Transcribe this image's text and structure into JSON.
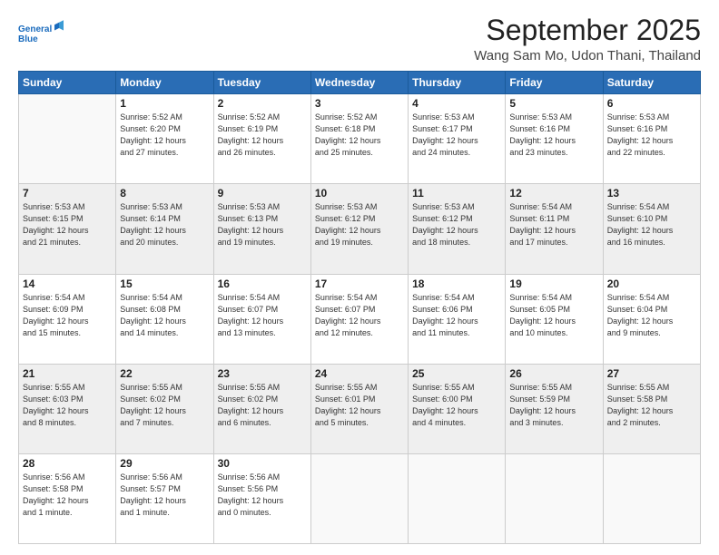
{
  "header": {
    "logo_line1": "General",
    "logo_line2": "Blue",
    "title": "September 2025",
    "subtitle": "Wang Sam Mo, Udon Thani, Thailand"
  },
  "days_of_week": [
    "Sunday",
    "Monday",
    "Tuesday",
    "Wednesday",
    "Thursday",
    "Friday",
    "Saturday"
  ],
  "weeks": [
    [
      {
        "num": "",
        "info": ""
      },
      {
        "num": "1",
        "info": "Sunrise: 5:52 AM\nSunset: 6:20 PM\nDaylight: 12 hours\nand 27 minutes."
      },
      {
        "num": "2",
        "info": "Sunrise: 5:52 AM\nSunset: 6:19 PM\nDaylight: 12 hours\nand 26 minutes."
      },
      {
        "num": "3",
        "info": "Sunrise: 5:52 AM\nSunset: 6:18 PM\nDaylight: 12 hours\nand 25 minutes."
      },
      {
        "num": "4",
        "info": "Sunrise: 5:53 AM\nSunset: 6:17 PM\nDaylight: 12 hours\nand 24 minutes."
      },
      {
        "num": "5",
        "info": "Sunrise: 5:53 AM\nSunset: 6:16 PM\nDaylight: 12 hours\nand 23 minutes."
      },
      {
        "num": "6",
        "info": "Sunrise: 5:53 AM\nSunset: 6:16 PM\nDaylight: 12 hours\nand 22 minutes."
      }
    ],
    [
      {
        "num": "7",
        "info": "Sunrise: 5:53 AM\nSunset: 6:15 PM\nDaylight: 12 hours\nand 21 minutes."
      },
      {
        "num": "8",
        "info": "Sunrise: 5:53 AM\nSunset: 6:14 PM\nDaylight: 12 hours\nand 20 minutes."
      },
      {
        "num": "9",
        "info": "Sunrise: 5:53 AM\nSunset: 6:13 PM\nDaylight: 12 hours\nand 19 minutes."
      },
      {
        "num": "10",
        "info": "Sunrise: 5:53 AM\nSunset: 6:12 PM\nDaylight: 12 hours\nand 19 minutes."
      },
      {
        "num": "11",
        "info": "Sunrise: 5:53 AM\nSunset: 6:12 PM\nDaylight: 12 hours\nand 18 minutes."
      },
      {
        "num": "12",
        "info": "Sunrise: 5:54 AM\nSunset: 6:11 PM\nDaylight: 12 hours\nand 17 minutes."
      },
      {
        "num": "13",
        "info": "Sunrise: 5:54 AM\nSunset: 6:10 PM\nDaylight: 12 hours\nand 16 minutes."
      }
    ],
    [
      {
        "num": "14",
        "info": "Sunrise: 5:54 AM\nSunset: 6:09 PM\nDaylight: 12 hours\nand 15 minutes."
      },
      {
        "num": "15",
        "info": "Sunrise: 5:54 AM\nSunset: 6:08 PM\nDaylight: 12 hours\nand 14 minutes."
      },
      {
        "num": "16",
        "info": "Sunrise: 5:54 AM\nSunset: 6:07 PM\nDaylight: 12 hours\nand 13 minutes."
      },
      {
        "num": "17",
        "info": "Sunrise: 5:54 AM\nSunset: 6:07 PM\nDaylight: 12 hours\nand 12 minutes."
      },
      {
        "num": "18",
        "info": "Sunrise: 5:54 AM\nSunset: 6:06 PM\nDaylight: 12 hours\nand 11 minutes."
      },
      {
        "num": "19",
        "info": "Sunrise: 5:54 AM\nSunset: 6:05 PM\nDaylight: 12 hours\nand 10 minutes."
      },
      {
        "num": "20",
        "info": "Sunrise: 5:54 AM\nSunset: 6:04 PM\nDaylight: 12 hours\nand 9 minutes."
      }
    ],
    [
      {
        "num": "21",
        "info": "Sunrise: 5:55 AM\nSunset: 6:03 PM\nDaylight: 12 hours\nand 8 minutes."
      },
      {
        "num": "22",
        "info": "Sunrise: 5:55 AM\nSunset: 6:02 PM\nDaylight: 12 hours\nand 7 minutes."
      },
      {
        "num": "23",
        "info": "Sunrise: 5:55 AM\nSunset: 6:02 PM\nDaylight: 12 hours\nand 6 minutes."
      },
      {
        "num": "24",
        "info": "Sunrise: 5:55 AM\nSunset: 6:01 PM\nDaylight: 12 hours\nand 5 minutes."
      },
      {
        "num": "25",
        "info": "Sunrise: 5:55 AM\nSunset: 6:00 PM\nDaylight: 12 hours\nand 4 minutes."
      },
      {
        "num": "26",
        "info": "Sunrise: 5:55 AM\nSunset: 5:59 PM\nDaylight: 12 hours\nand 3 minutes."
      },
      {
        "num": "27",
        "info": "Sunrise: 5:55 AM\nSunset: 5:58 PM\nDaylight: 12 hours\nand 2 minutes."
      }
    ],
    [
      {
        "num": "28",
        "info": "Sunrise: 5:56 AM\nSunset: 5:58 PM\nDaylight: 12 hours\nand 1 minute."
      },
      {
        "num": "29",
        "info": "Sunrise: 5:56 AM\nSunset: 5:57 PM\nDaylight: 12 hours\nand 1 minute."
      },
      {
        "num": "30",
        "info": "Sunrise: 5:56 AM\nSunset: 5:56 PM\nDaylight: 12 hours\nand 0 minutes."
      },
      {
        "num": "",
        "info": ""
      },
      {
        "num": "",
        "info": ""
      },
      {
        "num": "",
        "info": ""
      },
      {
        "num": "",
        "info": ""
      }
    ]
  ]
}
